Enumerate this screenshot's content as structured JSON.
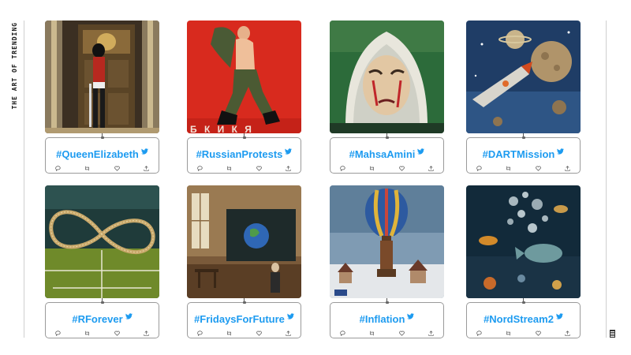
{
  "site": {
    "title": "THE ART OF TRENDING"
  },
  "colors": {
    "accent": "#1d9bf0",
    "border": "#9a9a9a",
    "text": "#111111"
  },
  "action_icons": [
    "reply-icon",
    "retweet-icon",
    "like-icon",
    "share-icon"
  ],
  "cards": [
    {
      "hashtag": "#QueenElizabeth",
      "image": "royal-guard-painting"
    },
    {
      "hashtag": "#RussianProtests",
      "image": "soldier-poster-painting"
    },
    {
      "hashtag": "#MahsaAmini",
      "image": "crying-woman-portrait"
    },
    {
      "hashtag": "#DARTMission",
      "image": "spacecraft-asteroid-painting"
    },
    {
      "hashtag": "#RForever",
      "image": "tennis-racket-infinity-painting"
    },
    {
      "hashtag": "#FridaysForFuture",
      "image": "classroom-globe-painting"
    },
    {
      "hashtag": "#Inflation",
      "image": "hot-air-balloon-town-painting"
    },
    {
      "hashtag": "#NordStream2",
      "image": "underwater-bubbles-painting"
    }
  ]
}
